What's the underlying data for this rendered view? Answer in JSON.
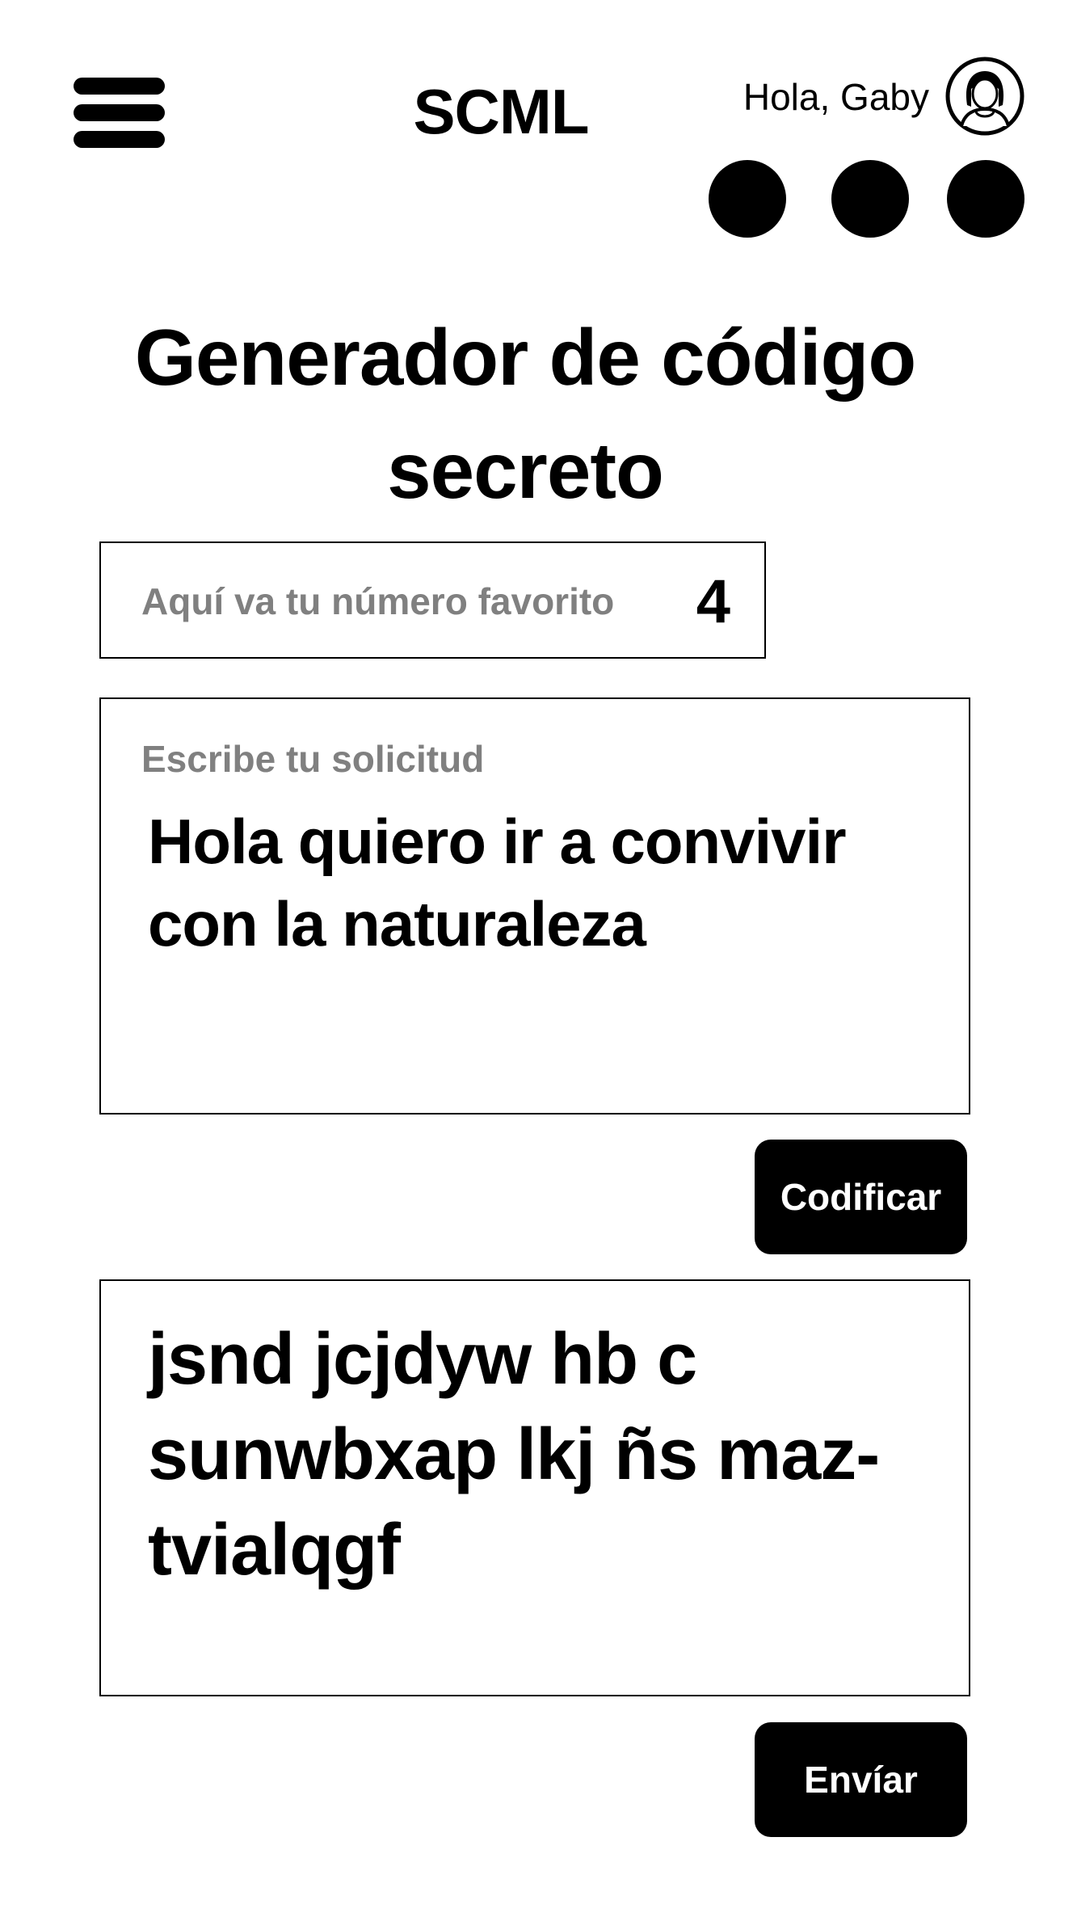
{
  "header": {
    "app_title": "SCML",
    "greeting": "Hola, Gaby",
    "menu_icon": "hamburger-menu-icon",
    "avatar_icon": "user-avatar-icon"
  },
  "page": {
    "title": "Generador de código secreto"
  },
  "favorite_number": {
    "placeholder": "Aquí va tu número favorito",
    "value": "4"
  },
  "request": {
    "label": "Escribe tu solicitud",
    "value": "Hola quiero ir a convivir con la naturaleza"
  },
  "encode_button": {
    "label": "Codificar"
  },
  "output": {
    "value": "jsnd jcjdyw hb c sunwbxap lkj ñs maz-tvialqgf"
  },
  "send_button": {
    "label": "Envíar"
  },
  "colors": {
    "text": "#000000",
    "placeholder": "#808080",
    "button_bg": "#000000",
    "button_text": "#ffffff"
  }
}
